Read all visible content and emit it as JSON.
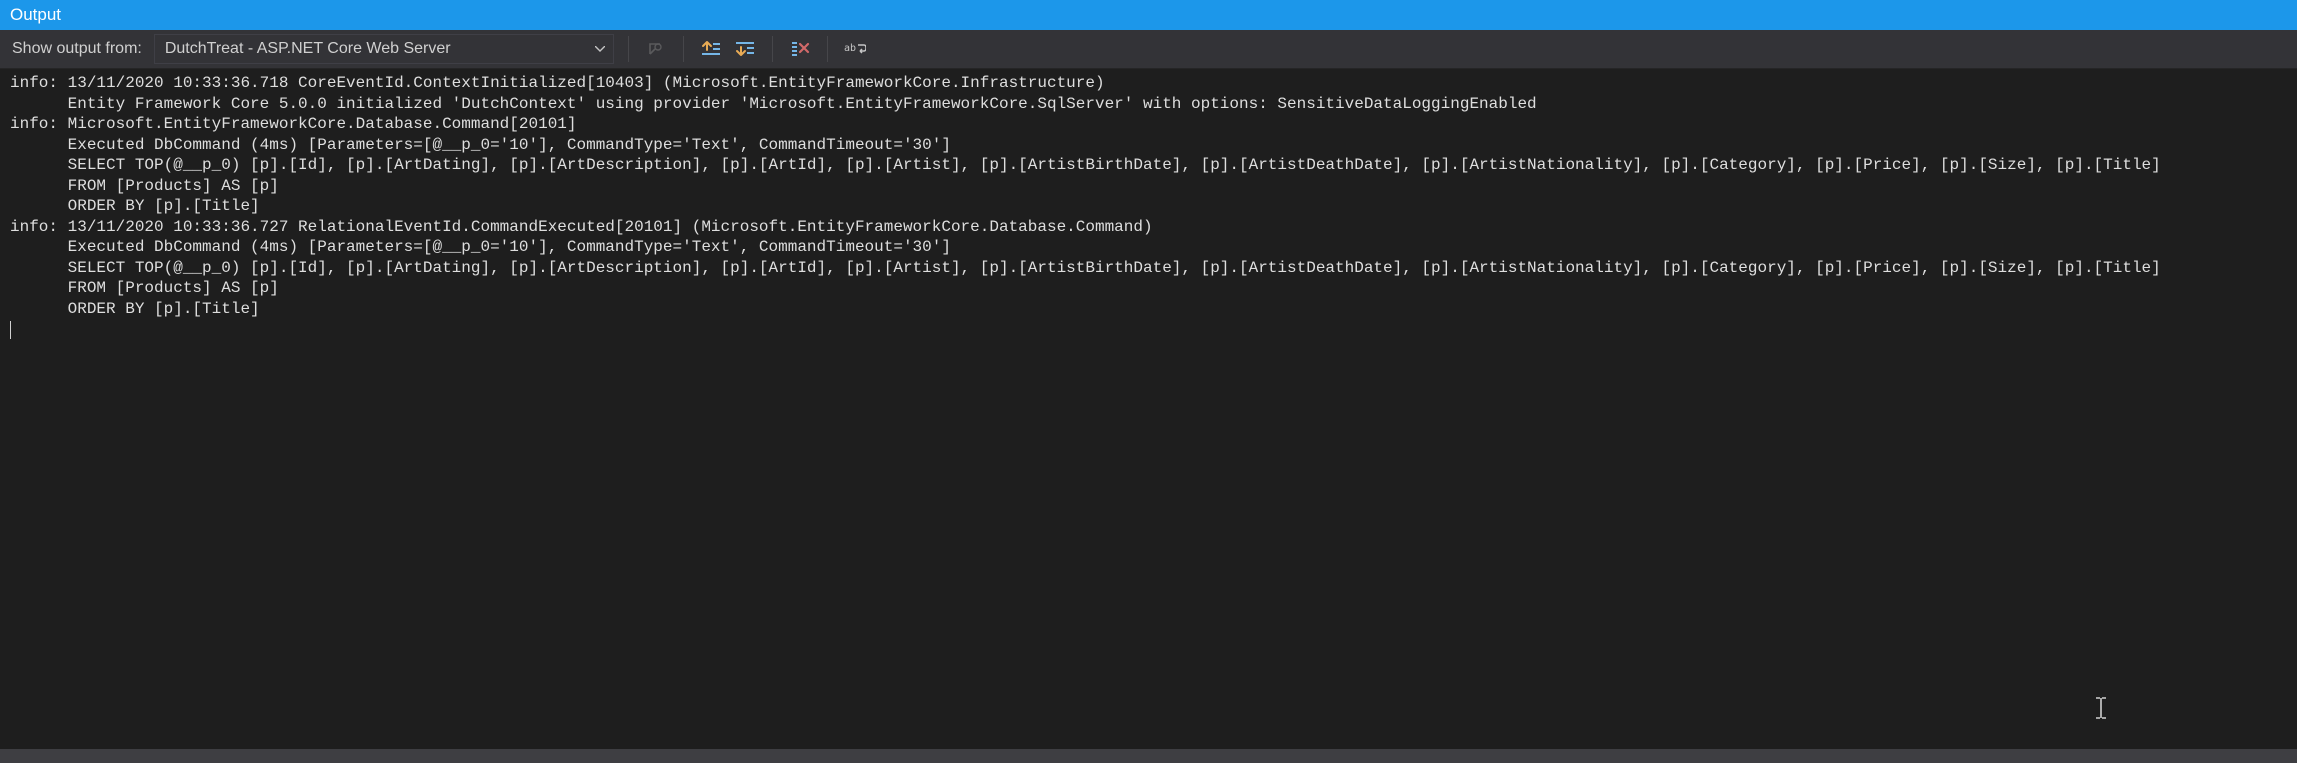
{
  "panel": {
    "title": "Output"
  },
  "toolbar": {
    "show_output_from_label": "Show output from:",
    "source_selected": "DutchTreat - ASP.NET Core Web Server"
  },
  "icons": {
    "find_message": "find-message-icon",
    "prev_message": "prev-message-icon",
    "next_message": "next-message-icon",
    "clear_all": "clear-all-icon",
    "word_wrap": "word-wrap-icon"
  },
  "colors": {
    "accent": "#1c97ea",
    "toolbar_bg": "#333337",
    "panel_bg": "#1e1e1e",
    "text": "#dedede"
  },
  "log": {
    "lines": [
      "info: 13/11/2020 10:33:36.718 CoreEventId.ContextInitialized[10403] (Microsoft.EntityFrameworkCore.Infrastructure)",
      "      Entity Framework Core 5.0.0 initialized 'DutchContext' using provider 'Microsoft.EntityFrameworkCore.SqlServer' with options: SensitiveDataLoggingEnabled",
      "info: Microsoft.EntityFrameworkCore.Database.Command[20101]",
      "      Executed DbCommand (4ms) [Parameters=[@__p_0='10'], CommandType='Text', CommandTimeout='30']",
      "      SELECT TOP(@__p_0) [p].[Id], [p].[ArtDating], [p].[ArtDescription], [p].[ArtId], [p].[Artist], [p].[ArtistBirthDate], [p].[ArtistDeathDate], [p].[ArtistNationality], [p].[Category], [p].[Price], [p].[Size], [p].[Title]",
      "      FROM [Products] AS [p]",
      "      ORDER BY [p].[Title]",
      "info: 13/11/2020 10:33:36.727 RelationalEventId.CommandExecuted[20101] (Microsoft.EntityFrameworkCore.Database.Command)",
      "      Executed DbCommand (4ms) [Parameters=[@__p_0='10'], CommandType='Text', CommandTimeout='30']",
      "      SELECT TOP(@__p_0) [p].[Id], [p].[ArtDating], [p].[ArtDescription], [p].[ArtId], [p].[Artist], [p].[ArtistBirthDate], [p].[ArtistDeathDate], [p].[ArtistNationality], [p].[Category], [p].[Price], [p].[Size], [p].[Title]",
      "      FROM [Products] AS [p]",
      "      ORDER BY [p].[Title]"
    ]
  }
}
